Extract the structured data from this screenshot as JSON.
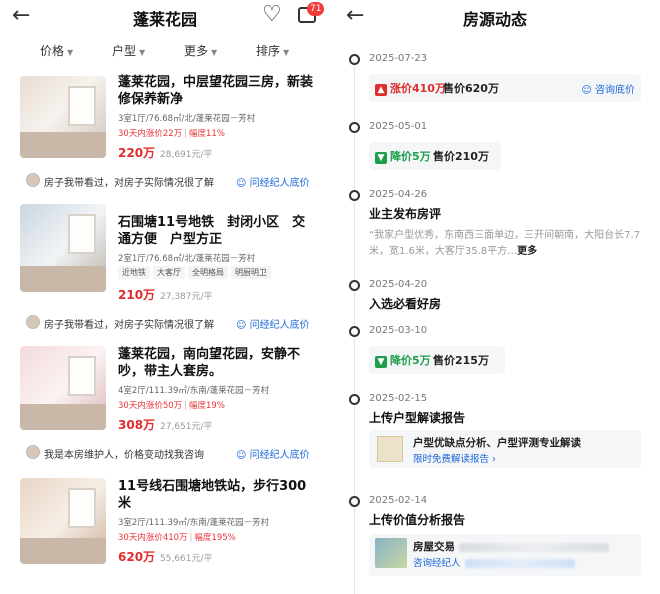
{
  "left": {
    "title": "蓬莱花园",
    "notification_count": "71",
    "filters": [
      "价格",
      "户型",
      "更多",
      "排序"
    ],
    "listings": [
      {
        "title": "蓬莱花园，中层望花园三房，新装修保养新净",
        "meta": "3室1厅/76.68㎡/北/蓬莱花园－芳村",
        "change": "30天内涨价22万",
        "change_pct": "幅度11%",
        "price": "220万",
        "unit_price": "28,691元/平",
        "agent_text": "房子我带看过，对房子实际情况很了解",
        "agent_link": "问经纪人底价"
      },
      {
        "title": "石围塘11号地铁　封闭小区　交通方便　户型方正",
        "meta": "2室1厅/76.68㎡/北/蓬莱花园－芳村",
        "tags": [
          "近地铁",
          "大客厅",
          "全明格局",
          "明厨明卫"
        ],
        "price": "210万",
        "unit_price": "27,387元/平",
        "agent_text": "房子我带看过，对房子实际情况很了解",
        "agent_link": "问经纪人底价"
      },
      {
        "title": "蓬莱花园，南向望花园，安静不吵，带主人套房。",
        "meta": "4室2厅/111.39㎡/东南/蓬莱花园－芳村",
        "change": "30天内涨价50万",
        "change_pct": "幅度19%",
        "price": "308万",
        "unit_price": "27,651元/平",
        "agent_text": "我是本房维护人，价格变动找我咨询",
        "agent_link": "问经纪人底价"
      },
      {
        "title": "11号线石围塘地铁站，步行300米",
        "meta": "3室2厅/111.39㎡/东南/蓬莱花园－芳村",
        "change": "30天内涨价410万",
        "change_pct": "幅度195%",
        "price": "620万",
        "unit_price": "55,661元/平"
      }
    ]
  },
  "right": {
    "title": "房源动态",
    "events": [
      {
        "date": "2025-07-23",
        "change": "涨价410万",
        "sell": "售价620万",
        "ask": "咨询底价"
      },
      {
        "date": "2025-05-01",
        "change": "降价5万",
        "sell": "售价210万"
      },
      {
        "date": "2025-04-26",
        "title": "业主发布房评",
        "review": "“我家户型优秀，东南西三面单边，三开间朝南，大阳台长7.7米，宽1.6米，大客厅35.8平方…",
        "more": "更多"
      },
      {
        "date": "2025-04-20",
        "title": "入选必看好房"
      },
      {
        "date": "2025-03-10",
        "change": "降价5万",
        "sell": "售价215万"
      },
      {
        "date": "2025-02-15",
        "title": "上传户型解读报告",
        "card_title": "户型优缺点分析、户型评测专业解读",
        "card_link": "限时免费解读报告 ›"
      },
      {
        "date": "2025-02-14",
        "title": "上传价值分析报告",
        "card_title": "房屋交易",
        "card_link": "咨询经纪人"
      }
    ]
  },
  "colors": {
    "price_red": "#e02d2d",
    "link_blue": "#1a66d9",
    "down_green": "#1e9e4a"
  }
}
